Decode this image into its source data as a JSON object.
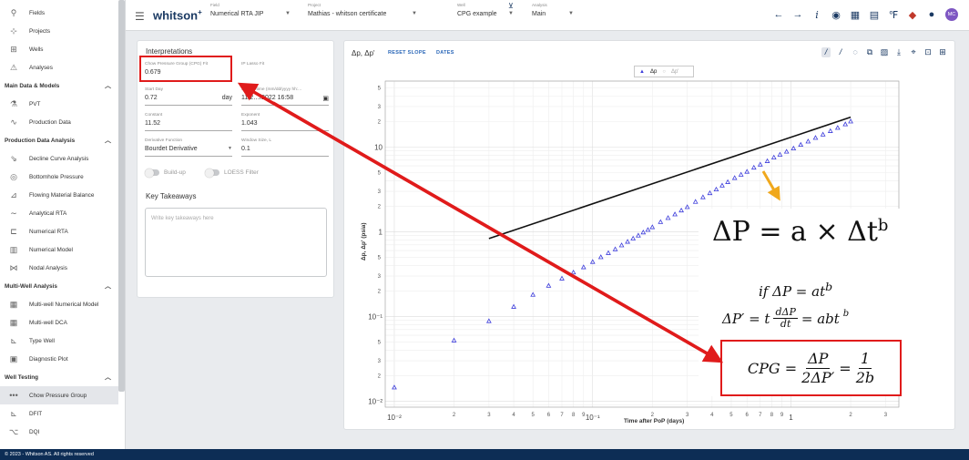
{
  "sidebar": {
    "top_items": [
      {
        "label": "Fields",
        "icon": "fields-icon"
      },
      {
        "label": "Projects",
        "icon": "projects-icon"
      },
      {
        "label": "Wells",
        "icon": "wells-icon"
      },
      {
        "label": "Analyses",
        "icon": "analyses-icon"
      }
    ],
    "sections": [
      {
        "title": "Main Data & Models",
        "items": [
          {
            "label": "PVT",
            "icon": "pvt-icon"
          },
          {
            "label": "Production Data",
            "icon": "production-data-icon"
          }
        ]
      },
      {
        "title": "Production Data Analysis",
        "items": [
          {
            "label": "Decline Curve Analysis",
            "icon": "decline-curve-icon"
          },
          {
            "label": "Bottomhole Pressure",
            "icon": "bottomhole-pressure-icon"
          },
          {
            "label": "Flowing Material Balance",
            "icon": "material-balance-icon"
          },
          {
            "label": "Analytical RTA",
            "icon": "analytical-rta-icon"
          },
          {
            "label": "Numerical RTA",
            "icon": "numerical-rta-icon"
          },
          {
            "label": "Numerical Model",
            "icon": "numerical-model-icon"
          },
          {
            "label": "Nodal Analysis",
            "icon": "nodal-analysis-icon"
          }
        ]
      },
      {
        "title": "Multi-Well Analysis",
        "items": [
          {
            "label": "Multi-well Numerical Model",
            "icon": "multiwell-model-icon"
          },
          {
            "label": "Multi-well DCA",
            "icon": "multiwell-dca-icon"
          },
          {
            "label": "Type Well",
            "icon": "type-well-icon"
          },
          {
            "label": "Diagnostic Plot",
            "icon": "diagnostic-plot-icon"
          }
        ]
      },
      {
        "title": "Well Testing",
        "items": [
          {
            "label": "Chow Pressure Group",
            "icon": "chow-pressure-group-icon"
          },
          {
            "label": "DFIT",
            "icon": "dfit-icon"
          },
          {
            "label": "DQI",
            "icon": "dqi-icon"
          }
        ]
      }
    ]
  },
  "topbar": {
    "logo": "whitson",
    "logo_sup": "+",
    "dropdowns": [
      {
        "caption": "Field",
        "value": "Numerical RTA JIP"
      },
      {
        "caption": "Project",
        "value": "Mathias - whitson certificate"
      },
      {
        "caption": "Well",
        "value": "CPG example"
      },
      {
        "caption": "Analysis",
        "value": "Main"
      }
    ],
    "avatar": "MC"
  },
  "interpretations": {
    "title": "Interpretations",
    "cpg_fit": {
      "label": "Chow Pressure Group (CPG) Fit",
      "value": "0.679"
    },
    "ip_lasso": {
      "label": "IP Lasso Fit",
      "value": ""
    },
    "start_day": {
      "label": "Start Day",
      "value": "0.72",
      "unit": "day"
    },
    "shutin_time": {
      "label": "Shut-in time (mm/dd/yyyy hh:...",
      "value": "11/2…/2022 16:58"
    },
    "constant": {
      "label": "Constant",
      "value": "11.52"
    },
    "exponent": {
      "label": "Exponent",
      "value": "1.043"
    },
    "derivative_function": {
      "label": "Derivative Function",
      "value": "Bourdet Derivative"
    },
    "window_size": {
      "label": "Window Size, L",
      "value": "0.1"
    },
    "buildup_label": "Build-up",
    "loess_label": "LOESS Filter",
    "key_takeaways_title": "Key Takeaways",
    "key_takeaways_placeholder": "Write key takeaways here"
  },
  "chart_panel": {
    "title": "Δp, Δp'",
    "reset_slope": "RESET SLOPE",
    "dates": "DATES",
    "legend": [
      "Δp",
      "Δp'"
    ],
    "xlabel": "Time after PoP (days)",
    "ylabel": "Δp, Δp' (psia)"
  },
  "chart_data": {
    "type": "scatter",
    "xscale": "log",
    "yscale": "log",
    "xlim": [
      0.009,
      3.5
    ],
    "ylim": [
      0.0085,
      60
    ],
    "xlabel": "Time after PoP (days)",
    "ylabel": "Δp, Δp' (psia)",
    "series": [
      {
        "name": "Δp",
        "marker": "triangle",
        "color": "#3d3ddb",
        "x": [
          0.01,
          0.02,
          0.03,
          0.04,
          0.05,
          0.06,
          0.07,
          0.08,
          0.09,
          0.1,
          0.11,
          0.12,
          0.13,
          0.14,
          0.15,
          0.16,
          0.17,
          0.18,
          0.19,
          0.2,
          0.22,
          0.24,
          0.26,
          0.28,
          0.3,
          0.33,
          0.36,
          0.39,
          0.42,
          0.45,
          0.48,
          0.52,
          0.56,
          0.6,
          0.65,
          0.7,
          0.76,
          0.82,
          0.88,
          0.95,
          1.03,
          1.12,
          1.22,
          1.33,
          1.45,
          1.58,
          1.72,
          1.88,
          2.0
        ],
        "y": [
          0.0145,
          0.052,
          0.088,
          0.13,
          0.18,
          0.23,
          0.28,
          0.33,
          0.38,
          0.44,
          0.5,
          0.56,
          0.62,
          0.69,
          0.76,
          0.83,
          0.9,
          0.98,
          1.05,
          1.13,
          1.3,
          1.45,
          1.6,
          1.78,
          1.95,
          2.25,
          2.55,
          2.85,
          3.15,
          3.5,
          3.85,
          4.3,
          4.7,
          5.1,
          5.7,
          6.2,
          6.8,
          7.5,
          8.1,
          8.8,
          9.6,
          10.6,
          11.6,
          12.8,
          14.0,
          15.4,
          16.8,
          18.5,
          20.0
        ]
      }
    ],
    "fit_line": {
      "x": [
        0.03,
        2.0
      ],
      "y": [
        0.83,
        22.5
      ],
      "color": "#111111"
    },
    "x_major_ticks": [
      "10⁻²",
      "10⁻¹",
      "1"
    ],
    "y_major_ticks": [
      "10⁻²",
      "10⁻¹",
      "1",
      "10"
    ],
    "grid": true,
    "legend_position": "top-center"
  },
  "formula": {
    "main": "ΔP = a × Δt",
    "main_exp": "b",
    "if_line": "if ΔP = at",
    "if_exp": "b",
    "deriv_lhs": "ΔP′ = t",
    "deriv_num": "dΔP",
    "deriv_den": "dt",
    "deriv_rhs": "= abt",
    "deriv_exp": "b",
    "cpg_lhs": "CPG =",
    "cpg_num": "ΔP",
    "cpg_den": "2ΔP′",
    "cpg_eq": "=",
    "cpg_num2": "1",
    "cpg_den2": "2b"
  },
  "colors": {
    "annotation_red": "#e01b1b",
    "highlight_orange": "#f0a81c",
    "brand_navy": "#0d2d55",
    "series_blue": "#3d3ddb"
  },
  "footer": "© 2023 - Whitson AS. All rights reserved"
}
